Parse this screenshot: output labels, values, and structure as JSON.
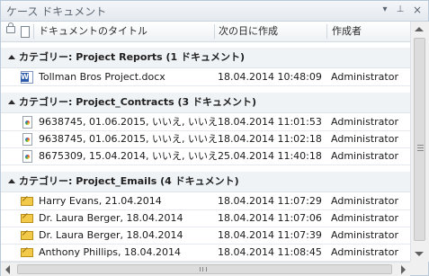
{
  "panel": {
    "title": "ケース ドキュメント",
    "menu_glyph": "▾",
    "pin_glyph": "⊥",
    "close_glyph": "×"
  },
  "columns": {
    "title": "ドキュメントのタイトル",
    "date": "次の日に作成",
    "author": "作成者"
  },
  "groups": [
    {
      "label": "カテゴリー: Project Reports (1 ドキュメント)",
      "rows": [
        {
          "icon": "word-document-icon",
          "title": "Tollman Bros Project.docx",
          "date": "18.04.2014 10:48:09",
          "author": "Administrator"
        }
      ]
    },
    {
      "label": "カテゴリー: Project_Contracts (3 ドキュメント)",
      "rows": [
        {
          "icon": "image-document-icon",
          "title": "9638745, 01.06.2015, いいえ, いいえ",
          "date": "18.04.2014 11:01:53",
          "author": "Administrator"
        },
        {
          "icon": "image-document-icon",
          "title": "9638745, 01.06.2015, いいえ, いいえ",
          "date": "18.04.2014 11:02:18",
          "author": "Administrator"
        },
        {
          "icon": "image-document-icon",
          "title": "8675309, 15.04.2014, いいえ, いいえ",
          "date": "25.04.2014 11:40:18",
          "author": "Administrator"
        }
      ]
    },
    {
      "label": "カテゴリー: Project_Emails (4 ドキュメント)",
      "rows": [
        {
          "icon": "envelope-icon",
          "title": "Harry Evans, 21.04.2014",
          "date": "18.04.2014 11:07:29",
          "author": "Administrator"
        },
        {
          "icon": "envelope-icon",
          "title": "Dr. Laura Berger, 18.04.2014",
          "date": "18.04.2014 11:07:06",
          "author": "Administrator"
        },
        {
          "icon": "envelope-icon",
          "title": "Dr. Laura Berger, 18.04.2014",
          "date": "18.04.2014 11:07:39",
          "author": "Administrator"
        },
        {
          "icon": "envelope-icon",
          "title": "Anthony Phillips, 18.04.2014",
          "date": "18.04.2014 11:08:45",
          "author": "Administrator"
        }
      ]
    }
  ]
}
